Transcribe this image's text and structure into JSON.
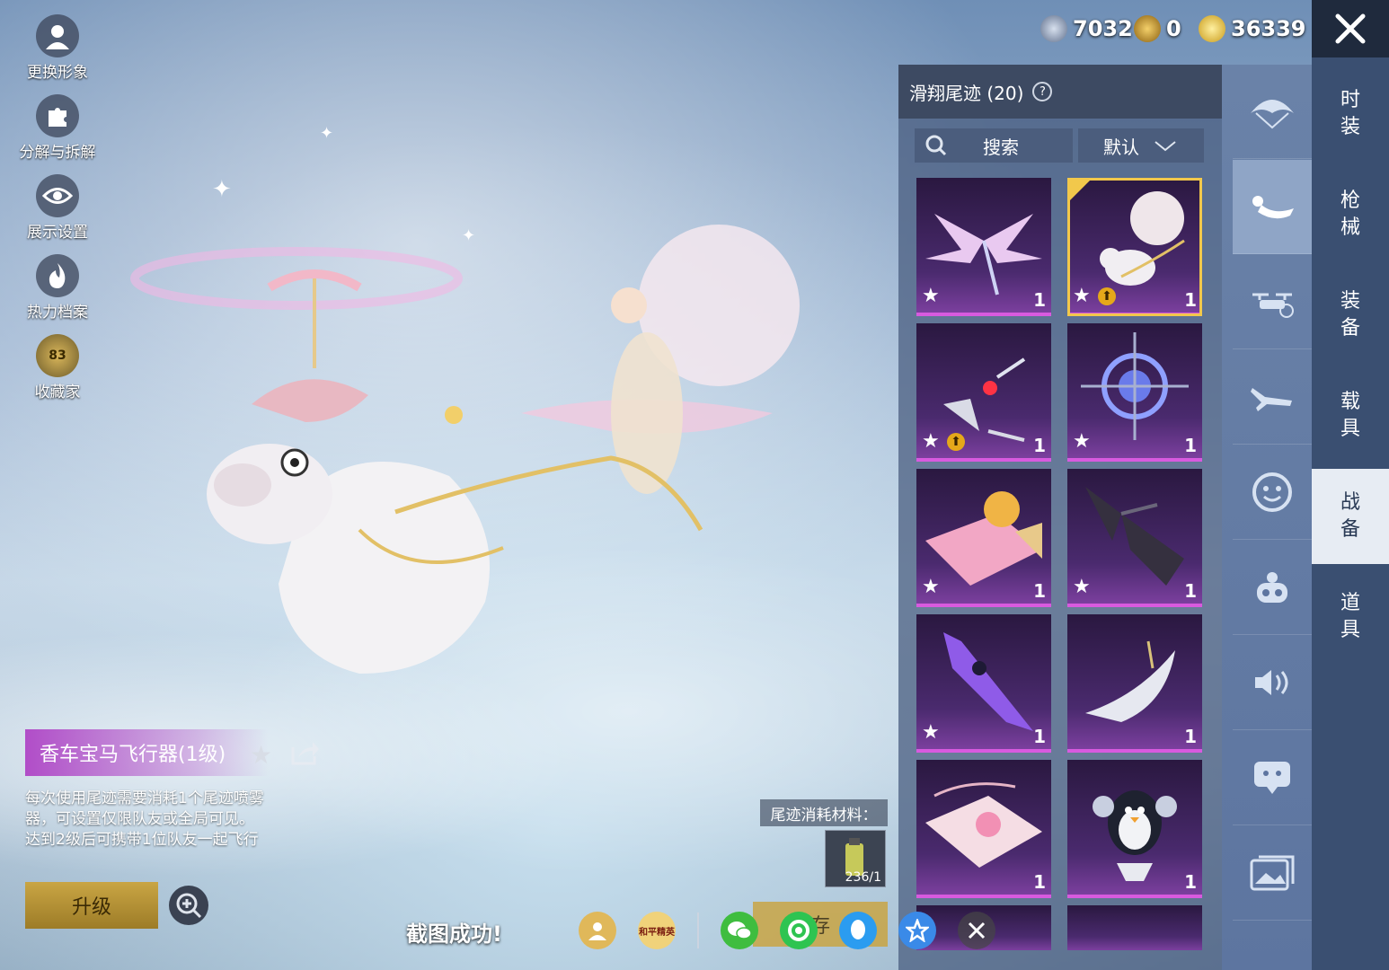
{
  "currency": [
    {
      "icon": "coin-icon",
      "value": "7032",
      "color": "#9aa9c2"
    },
    {
      "icon": "medal-icon",
      "value": "0",
      "color": "#d6a02a"
    },
    {
      "icon": "lightning-coin-icon",
      "value": "36339",
      "color": "#e8c33c"
    }
  ],
  "left_menu": [
    {
      "label": "更换形象",
      "icon": "avatar-icon"
    },
    {
      "label": "分解与拆解",
      "icon": "puzzle-icon"
    },
    {
      "label": "展示设置",
      "icon": "eye-icon"
    },
    {
      "label": "热力档案",
      "icon": "flame-icon"
    },
    {
      "label": "收藏家",
      "icon": "collector-badge-icon",
      "badge": "83"
    }
  ],
  "categories": [
    {
      "label": "时装"
    },
    {
      "label": "枪械"
    },
    {
      "label": "装备"
    },
    {
      "label": "载具"
    },
    {
      "label": "战备",
      "active": true
    },
    {
      "label": "道具"
    }
  ],
  "subcategories": [
    {
      "icon": "parachute-icon"
    },
    {
      "icon": "glide-trail-icon",
      "active": true
    },
    {
      "icon": "drone-icon"
    },
    {
      "icon": "airplane-icon"
    },
    {
      "icon": "emote-icon"
    },
    {
      "icon": "companion-icon"
    },
    {
      "icon": "voice-icon"
    },
    {
      "icon": "chat-bubble-icon"
    },
    {
      "icon": "gallery-icon"
    }
  ],
  "panel": {
    "title": "滑翔尾迹 (20)",
    "search_label": "搜索",
    "sort_label": "默认"
  },
  "items": [
    {
      "name": "pink-wings",
      "count": "1",
      "selected": false,
      "upgrade": false
    },
    {
      "name": "unicorn-carriage",
      "count": "1",
      "selected": true,
      "upgrade": true
    },
    {
      "name": "red-orb-wing",
      "count": "1",
      "selected": false,
      "upgrade": true
    },
    {
      "name": "blue-compass",
      "count": "1",
      "selected": false,
      "upgrade": false
    },
    {
      "name": "cat-bed",
      "count": "1",
      "selected": false,
      "upgrade": false
    },
    {
      "name": "dark-bat-wings",
      "count": "1",
      "selected": false,
      "upgrade": false
    },
    {
      "name": "purple-blade",
      "count": "1",
      "selected": false,
      "upgrade": false
    },
    {
      "name": "white-lamp",
      "count": "1",
      "selected": false,
      "upgrade": false
    },
    {
      "name": "flower-cart",
      "count": "1",
      "selected": false,
      "upgrade": false
    },
    {
      "name": "penguin-jetpack",
      "count": "1",
      "selected": false,
      "upgrade": false
    }
  ],
  "detail": {
    "title": "香车宝马飞行器(1级)",
    "description": "每次使用尾迹需要消耗1个尾迹喷雾器，可设置仅限队友或全局可见。达到2级后可携带1位队友一起飞行",
    "upgrade_label": "升级",
    "material_label": "尾迹消耗材料：",
    "material_count": "236/1"
  },
  "screenshot": {
    "success_text": "截图成功!",
    "save_label": "存",
    "share_icons": [
      {
        "icon": "profile-share-icon",
        "color": "#e0b85a"
      },
      {
        "icon": "game-logo-icon",
        "color": "#f0d27a",
        "text": "和平精英"
      },
      {
        "icon": "wechat-icon",
        "color": "#3fbd3f"
      },
      {
        "icon": "moments-icon",
        "color": "#2ec451"
      },
      {
        "icon": "qq-icon",
        "color": "#2b9cf0"
      },
      {
        "icon": "qzone-icon",
        "color": "#3a8ae8"
      },
      {
        "icon": "close-icon",
        "color": "#444"
      }
    ]
  }
}
